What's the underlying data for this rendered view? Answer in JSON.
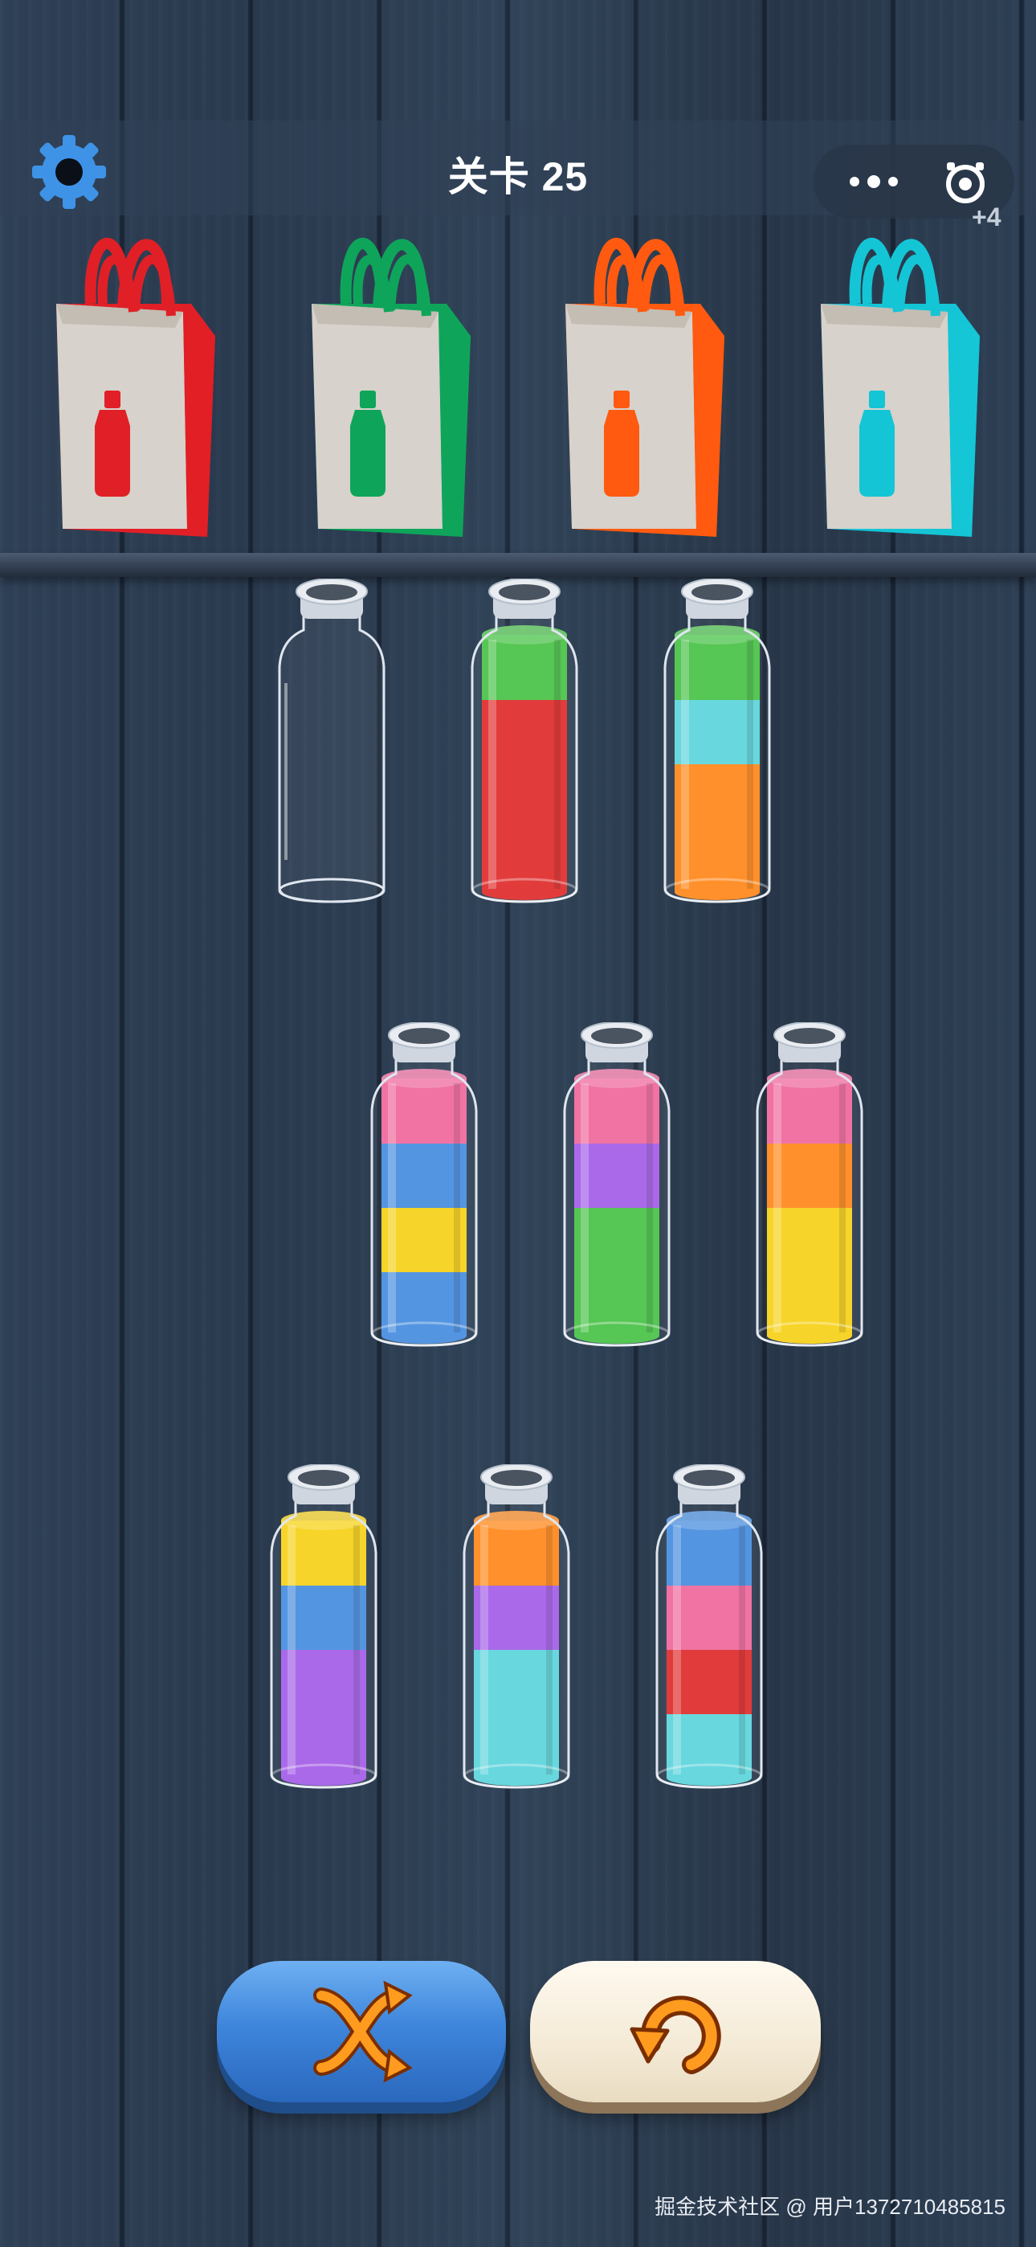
{
  "header": {
    "level_label": "关卡 25",
    "bonus_count": "+4",
    "settings_icon": "gear-icon",
    "menu_icon": "more-dots-icon",
    "close_icon": "target-close-icon"
  },
  "bags": [
    {
      "color": "#e02026",
      "name": "red"
    },
    {
      "color": "#0ea55a",
      "name": "green"
    },
    {
      "color": "#ff5a10",
      "name": "orange"
    },
    {
      "color": "#14c5d6",
      "name": "cyan"
    }
  ],
  "bottles": [
    {
      "layers": []
    },
    {
      "layers": [
        "red",
        "red",
        "red",
        "green"
      ]
    },
    {
      "layers": [
        "orange",
        "orange",
        "cyan",
        "green"
      ]
    },
    {
      "layers": [
        "blue",
        "yellow",
        "blue",
        "pink"
      ]
    },
    {
      "layers": [
        "green",
        "green",
        "purple",
        "pink"
      ]
    },
    {
      "layers": [
        "yellow",
        "yellow",
        "orange",
        "pink"
      ]
    },
    {
      "layers": [
        "purple",
        "purple",
        "blue",
        "yellow"
      ]
    },
    {
      "layers": [
        "cyan",
        "cyan",
        "purple",
        "orange"
      ]
    },
    {
      "layers": [
        "cyan",
        "red",
        "pink",
        "blue"
      ]
    }
  ],
  "colors": {
    "red": "#e0302f",
    "green": "#4cc34a",
    "orange": "#ff8a1e",
    "cyan": "#5fd6dc",
    "blue": "#4a8fe0",
    "yellow": "#f7d21c",
    "pink": "#f06b9e",
    "purple": "#a560e8"
  },
  "controls": {
    "shuffle_icon": "shuffle-icon",
    "undo_icon": "undo-icon"
  },
  "footer": {
    "watermark": "掘金技术社区 @ 用户1372710485815"
  }
}
